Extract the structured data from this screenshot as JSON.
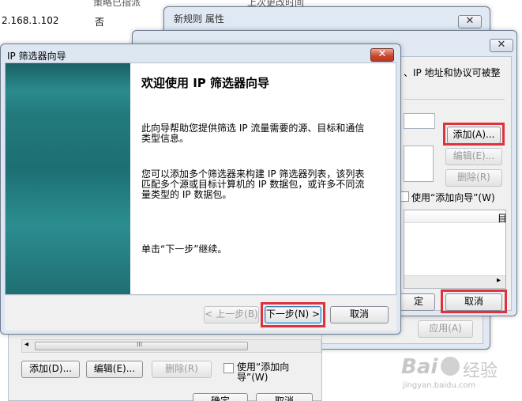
{
  "bg_table": {
    "row_ip": "2.168.1.102",
    "row_assigned": "否",
    "header_policy": "策略已指派",
    "header_modified": "上次更改时间"
  },
  "prop_window": {
    "title": "新规则 属性",
    "close_symbol": "✕",
    "apply_button": "应用(A)",
    "ok_button": "确定",
    "cancel_button": "取消"
  },
  "filter_list_window": {
    "close_symbol": "✕",
    "desc_text": "、IP 地址和协议可被整",
    "add_button": "添加(A)...",
    "edit_button": "编辑(E)...",
    "delete_button": "删除(R)",
    "use_wizard_label": "使用“添加向导”(W)",
    "col_head_right": "目",
    "ok_button_partial": "定",
    "cancel_button": "取消"
  },
  "rule_window_bottom": {
    "add_button": "添加(D)...",
    "edit_button": "编辑(E)...",
    "delete_button": "删除(R)",
    "use_wizard_label_1": "使用“添加向",
    "use_wizard_label_2": "导”(W)",
    "ok_button": "确定",
    "cancel_button": "取消",
    "scroll_left": "◂",
    "scroll_grip": "III"
  },
  "wizard": {
    "title": "IP 筛选器向导",
    "close_symbol": "✕",
    "heading": "欢迎使用 IP 筛选器向导",
    "para1_line1": "此向导帮助您提供筛选 IP 流量需要的源、目标和通信",
    "para1_line2": "类型信息。",
    "para2_line1": "您可以添加多个筛选器来构建 IP 筛选器列表，该列表",
    "para2_line2": "匹配多个源或目标计算机的 IP 数据包，或许多不同流",
    "para2_line3": "量类型的 IP 数据包。",
    "para3": "单击“下一步”继续。",
    "back_button": "< 上一步(B)",
    "next_button": "下一步(N) >",
    "cancel_button": "取消"
  },
  "watermark": {
    "brand": "Bai",
    "brand_cn": "经验",
    "site": "jingyan.baidu.com"
  },
  "colors": {
    "highlight": "#e0323c",
    "wizard_left_panel": "#1f6f73"
  }
}
